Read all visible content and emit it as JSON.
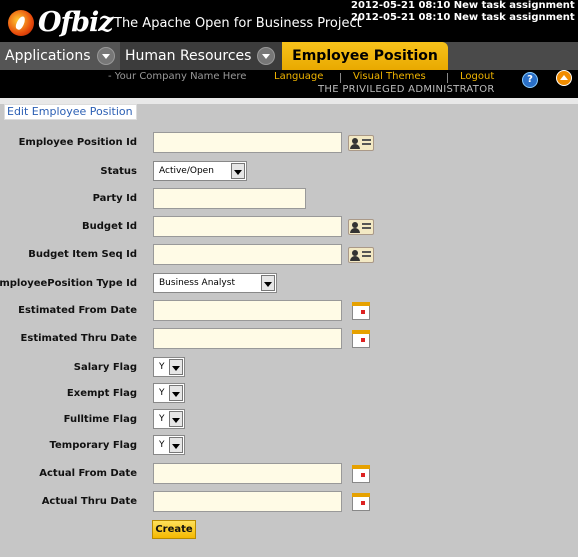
{
  "header": {
    "logo_text": "Ofbiz",
    "site_title": "The Apache Open for Business Project",
    "notifications": [
      "2012-05-21 08:10 New task assignment",
      "2012-05-21 08:10 New task assignment"
    ]
  },
  "tabs": {
    "applications": "Applications",
    "human_resources": "Human Resources",
    "active": "Employee Position"
  },
  "subbar": {
    "company": "- Your Company Name Here",
    "language": "Language",
    "visual_themes": "Visual Themes",
    "logout": "Logout",
    "user": "THE PRIVILEGED ADMINISTRATOR",
    "help_label": "?"
  },
  "form": {
    "title": "Edit Employee Position",
    "fields": {
      "employee_position_id": {
        "label": "Employee Position Id",
        "value": ""
      },
      "status": {
        "label": "Status",
        "value": "Active/Open"
      },
      "party_id": {
        "label": "Party Id",
        "value": ""
      },
      "budget_id": {
        "label": "Budget Id",
        "value": ""
      },
      "budget_item_seq_id": {
        "label": "Budget Item Seq Id",
        "value": ""
      },
      "employee_position_type_id": {
        "label": "EmployeePosition Type Id",
        "value": "Business Analyst"
      },
      "estimated_from_date": {
        "label": "Estimated From Date",
        "value": ""
      },
      "estimated_thru_date": {
        "label": "Estimated Thru Date",
        "value": ""
      },
      "salary_flag": {
        "label": "Salary Flag",
        "value": "Y"
      },
      "exempt_flag": {
        "label": "Exempt Flag",
        "value": "Y"
      },
      "fulltime_flag": {
        "label": "Fulltime Flag",
        "value": "Y"
      },
      "temporary_flag": {
        "label": "Temporary Flag",
        "value": "Y"
      },
      "actual_from_date": {
        "label": "Actual From Date",
        "value": ""
      },
      "actual_thru_date": {
        "label": "Actual Thru Date",
        "value": ""
      }
    },
    "create_label": "Create"
  },
  "colors": {
    "accent": "#f4b800",
    "input_background": "#fffbe6",
    "page_background": "#c6c6c6",
    "link": "#2b5fb4"
  }
}
